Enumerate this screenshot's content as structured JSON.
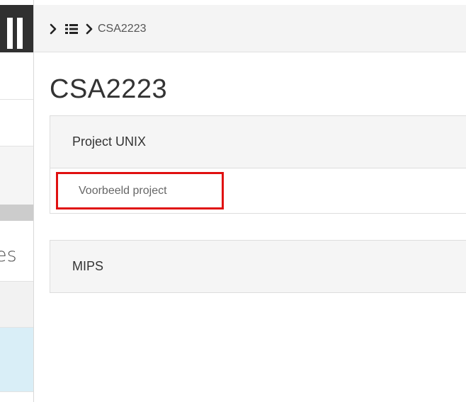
{
  "breadcrumb": {
    "separator_icon": "chevron-right-icon",
    "list_icon": "list-icon",
    "current": "CSA2223"
  },
  "page": {
    "title": "CSA2223"
  },
  "sidebar": {
    "partial_label": "es"
  },
  "panels": [
    {
      "heading": "Project UNIX",
      "items": [
        {
          "label": "Voorbeeld project",
          "highlighted": true
        }
      ]
    },
    {
      "heading": "MIPS",
      "items": []
    }
  ],
  "colors": {
    "sidebar_dark": "#303030",
    "topbar": "#f4f4f4",
    "panel_heading": "#f5f5f5",
    "highlight": "#e01010",
    "sidebar_active": "#d9eef7"
  }
}
